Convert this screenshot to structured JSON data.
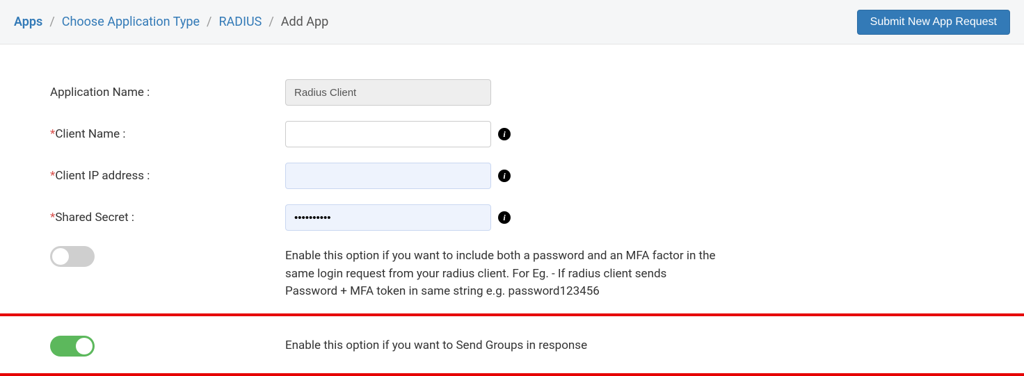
{
  "breadcrumb": {
    "apps": "Apps",
    "choose_type": "Choose Application Type",
    "radius": "RADIUS",
    "current": "Add App"
  },
  "header": {
    "submit_label": "Submit New App Request"
  },
  "form": {
    "app_name_label": "Application Name :",
    "app_name_value": "Radius Client",
    "client_name_label": "Client Name :",
    "client_name_value": "",
    "client_ip_label": "Client IP address :",
    "client_ip_value": "",
    "shared_secret_label": "Shared Secret :",
    "shared_secret_value": "••••••••••",
    "toggle1_desc": "Enable this option if you want to include both a password and an MFA factor in the same login request from your radius client. For Eg. - If radius client sends Password + MFA token in same string e.g. password123456",
    "toggle2_desc": "Enable this option if you want to Send Groups in response"
  }
}
